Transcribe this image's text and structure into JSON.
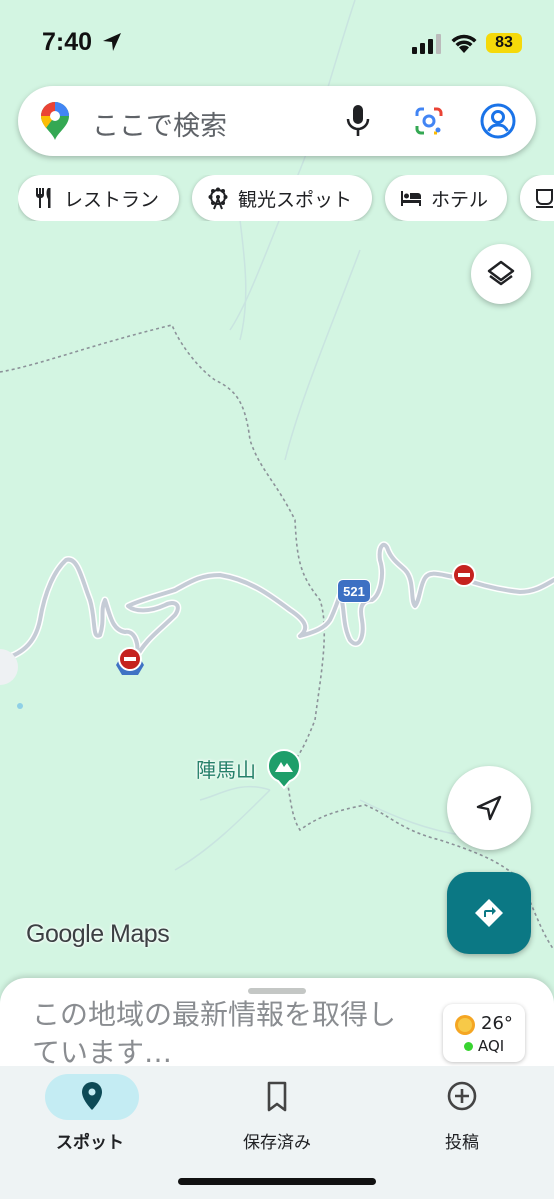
{
  "status_bar": {
    "time": "7:40",
    "battery": "83"
  },
  "search": {
    "placeholder": "ここで検索"
  },
  "chips": [
    {
      "label": "レストラン",
      "icon": "restaurant-icon"
    },
    {
      "label": "観光スポット",
      "icon": "ferris-wheel-icon"
    },
    {
      "label": "ホテル",
      "icon": "bed-icon"
    },
    {
      "label": "",
      "icon": "coffee-icon"
    }
  ],
  "map": {
    "route_number": "521",
    "place_label": "陣馬山",
    "attribution": "Google Maps",
    "colors": {
      "land": "#d3f5e2",
      "road": "#c5ccd6",
      "accent": "#0b7884",
      "peak": "#1e9e6a",
      "closure": "#c5221f"
    }
  },
  "sheet": {
    "message": "この地域の最新情報を取得しています…",
    "weather": {
      "temperature": "26°",
      "aqi_label": "AQI"
    }
  },
  "nav": {
    "items": [
      {
        "label": "スポット",
        "icon": "place-icon",
        "active": true
      },
      {
        "label": "保存済み",
        "icon": "bookmark-icon",
        "active": false
      },
      {
        "label": "投稿",
        "icon": "add-circle-icon",
        "active": false
      }
    ]
  }
}
